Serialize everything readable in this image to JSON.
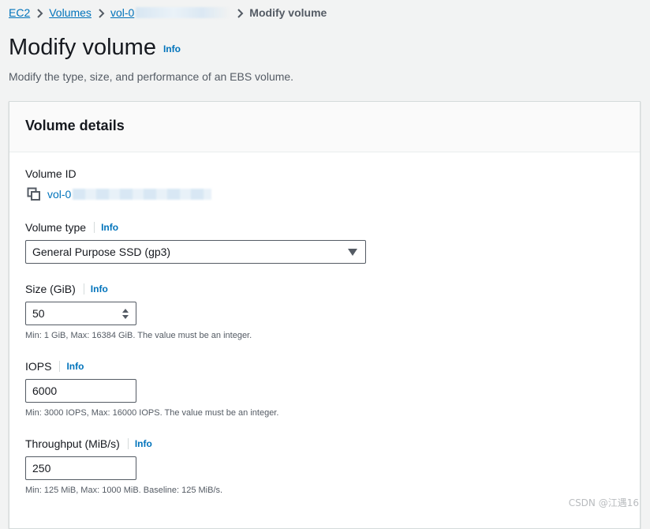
{
  "breadcrumb": {
    "items": [
      "EC2",
      "Volumes",
      "vol-0"
    ],
    "current": "Modify volume"
  },
  "header": {
    "title": "Modify volume",
    "info": "Info",
    "description": "Modify the type, size, and performance of an EBS volume."
  },
  "panel": {
    "title": "Volume details",
    "volume_id": {
      "label": "Volume ID",
      "value": "vol-0",
      "icon": "copy-icon"
    },
    "volume_type": {
      "label": "Volume type",
      "info": "Info",
      "selected": "General Purpose SSD (gp3)"
    },
    "size": {
      "label": "Size (GiB)",
      "info": "Info",
      "value": "50",
      "constraint": "Min: 1 GiB, Max: 16384 GiB. The value must be an integer."
    },
    "iops": {
      "label": "IOPS",
      "info": "Info",
      "value": "6000",
      "constraint": "Min: 3000 IOPS, Max: 16000 IOPS. The value must be an integer."
    },
    "throughput": {
      "label": "Throughput (MiB/s)",
      "info": "Info",
      "value": "250",
      "constraint": "Min: 125 MiB, Max: 1000 MiB. Baseline: 125 MiB/s."
    }
  },
  "watermark": "CSDN @江遇16",
  "colors": {
    "link": "#0073bb",
    "text": "#16191f",
    "muted": "#545b64",
    "background": "#f2f3f3",
    "panel_header": "#fafafa"
  }
}
